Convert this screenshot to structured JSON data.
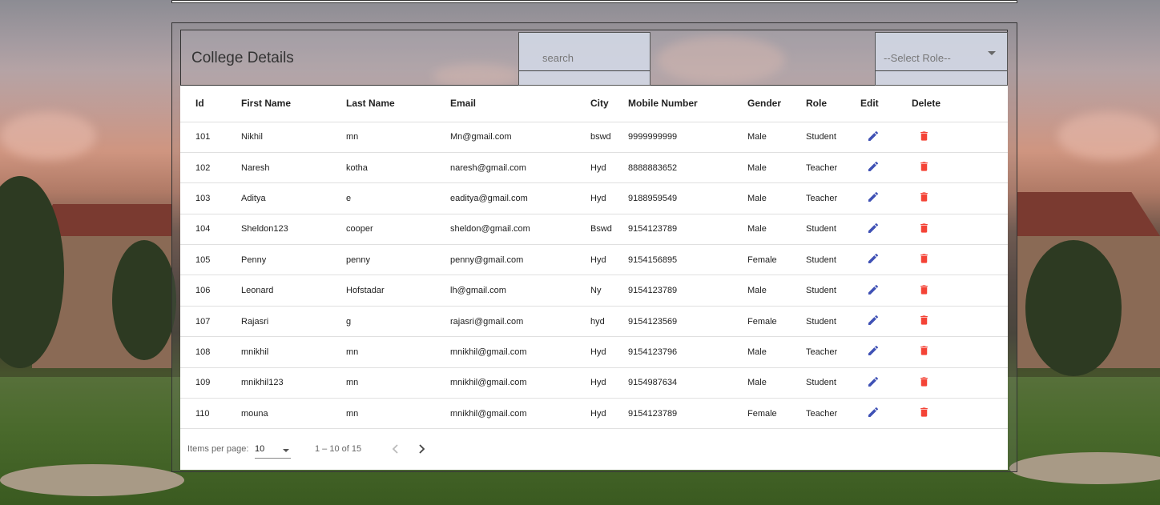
{
  "header": {
    "title": "College Details",
    "search_placeholder": "search",
    "role_placeholder": "--Select Role--"
  },
  "table": {
    "columns": [
      "Id",
      "First Name",
      "Last Name",
      "Email",
      "City",
      "Mobile Number",
      "Gender",
      "Role",
      "Edit",
      "Delete"
    ],
    "rows": [
      {
        "id": "101",
        "first": "Nikhil",
        "last": "mn",
        "email": "Mn@gmail.com",
        "city": "bswd",
        "mobile": "9999999999",
        "gender": "Male",
        "role": "Student"
      },
      {
        "id": "102",
        "first": "Naresh",
        "last": "kotha",
        "email": "naresh@gmail.com",
        "city": "Hyd",
        "mobile": "8888883652",
        "gender": "Male",
        "role": "Teacher"
      },
      {
        "id": "103",
        "first": "Aditya",
        "last": "e",
        "email": "eaditya@gmail.com",
        "city": "Hyd",
        "mobile": "9188959549",
        "gender": "Male",
        "role": "Teacher"
      },
      {
        "id": "104",
        "first": "Sheldon123",
        "last": "cooper",
        "email": "sheldon@gmail.com",
        "city": "Bswd",
        "mobile": "9154123789",
        "gender": "Male",
        "role": "Student"
      },
      {
        "id": "105",
        "first": "Penny",
        "last": "penny",
        "email": "penny@gmail.com",
        "city": "Hyd",
        "mobile": "9154156895",
        "gender": "Female",
        "role": "Student"
      },
      {
        "id": "106",
        "first": "Leonard",
        "last": "Hofstadar",
        "email": "lh@gmail.com",
        "city": "Ny",
        "mobile": "9154123789",
        "gender": "Male",
        "role": "Student"
      },
      {
        "id": "107",
        "first": "Rajasri",
        "last": "g",
        "email": "rajasri@gmail.com",
        "city": "hyd",
        "mobile": "9154123569",
        "gender": "Female",
        "role": "Student"
      },
      {
        "id": "108",
        "first": "mnikhil",
        "last": "mn",
        "email": "mnikhil@gmail.com",
        "city": "Hyd",
        "mobile": "9154123796",
        "gender": "Male",
        "role": "Teacher"
      },
      {
        "id": "109",
        "first": "mnikhil123",
        "last": "mn",
        "email": "mnikhil@gmail.com",
        "city": "Hyd",
        "mobile": "9154987634",
        "gender": "Male",
        "role": "Student"
      },
      {
        "id": "110",
        "first": "mouna",
        "last": "mn",
        "email": "mnikhil@gmail.com",
        "city": "Hyd",
        "mobile": "9154123789",
        "gender": "Female",
        "role": "Teacher"
      }
    ]
  },
  "paginator": {
    "items_per_page_label": "Items per page:",
    "page_size": "10",
    "range_label": "1 – 10 of 15"
  },
  "icons": {
    "edit": "edit-pencil-icon",
    "delete": "delete-trash-icon",
    "prev": "chevron-left-icon",
    "next": "chevron-right-icon"
  },
  "colors": {
    "edit_icon": "#3f51b5",
    "delete_icon": "#f44336"
  }
}
